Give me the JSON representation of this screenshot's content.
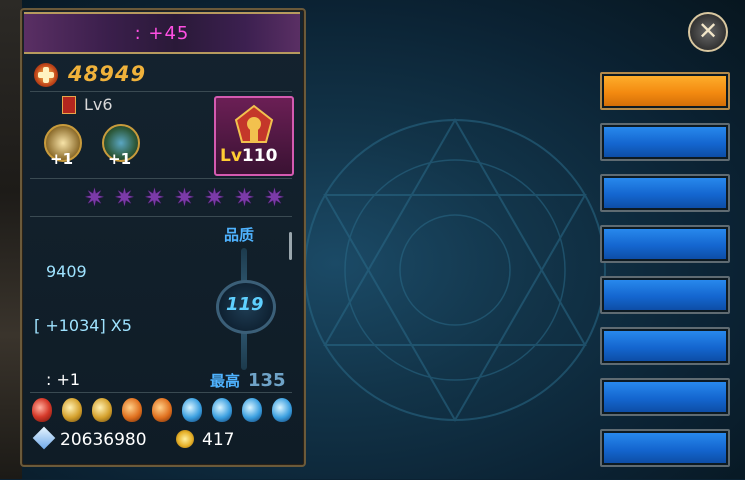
{
  "header": {
    "title": ":  +45"
  },
  "power": {
    "value": "48949",
    "icon": "power-emblem-icon"
  },
  "level": {
    "label": "Lv6"
  },
  "skills": [
    {
      "plus": "+1"
    },
    {
      "plus": "+1"
    }
  ],
  "equipment": {
    "level_prefix": "Lv",
    "level_value": "110"
  },
  "stars": {
    "count": 7,
    "color": "#7b3aa8"
  },
  "stats": {
    "value1": "9409",
    "bonus": "[  +1034] X5",
    "extra": ":  +1"
  },
  "gauge": {
    "quality_label": "品质",
    "current": "119",
    "best_label": "最高",
    "best_value": "135"
  },
  "gems": [
    "red",
    "gold",
    "gold",
    "orange",
    "orange",
    "blue",
    "blue",
    "blue",
    "blue"
  ],
  "currency": {
    "diamonds": "20636980",
    "coins": "417"
  },
  "side_buttons": [
    {
      "label": "",
      "color": "orange"
    },
    {
      "label": "",
      "color": "blue"
    },
    {
      "label": "",
      "color": "blue"
    },
    {
      "label": "",
      "color": "blue"
    },
    {
      "label": "",
      "color": "blue"
    },
    {
      "label": "",
      "color": "blue"
    },
    {
      "label": "",
      "color": "blue"
    },
    {
      "label": "",
      "color": "blue"
    }
  ],
  "close": {
    "glyph": "✕"
  },
  "colors": {
    "accent_title": "#ff4fe3",
    "power": "#f0b23b",
    "stat": "#9fe3ff",
    "gauge": "#5fd0ff"
  }
}
